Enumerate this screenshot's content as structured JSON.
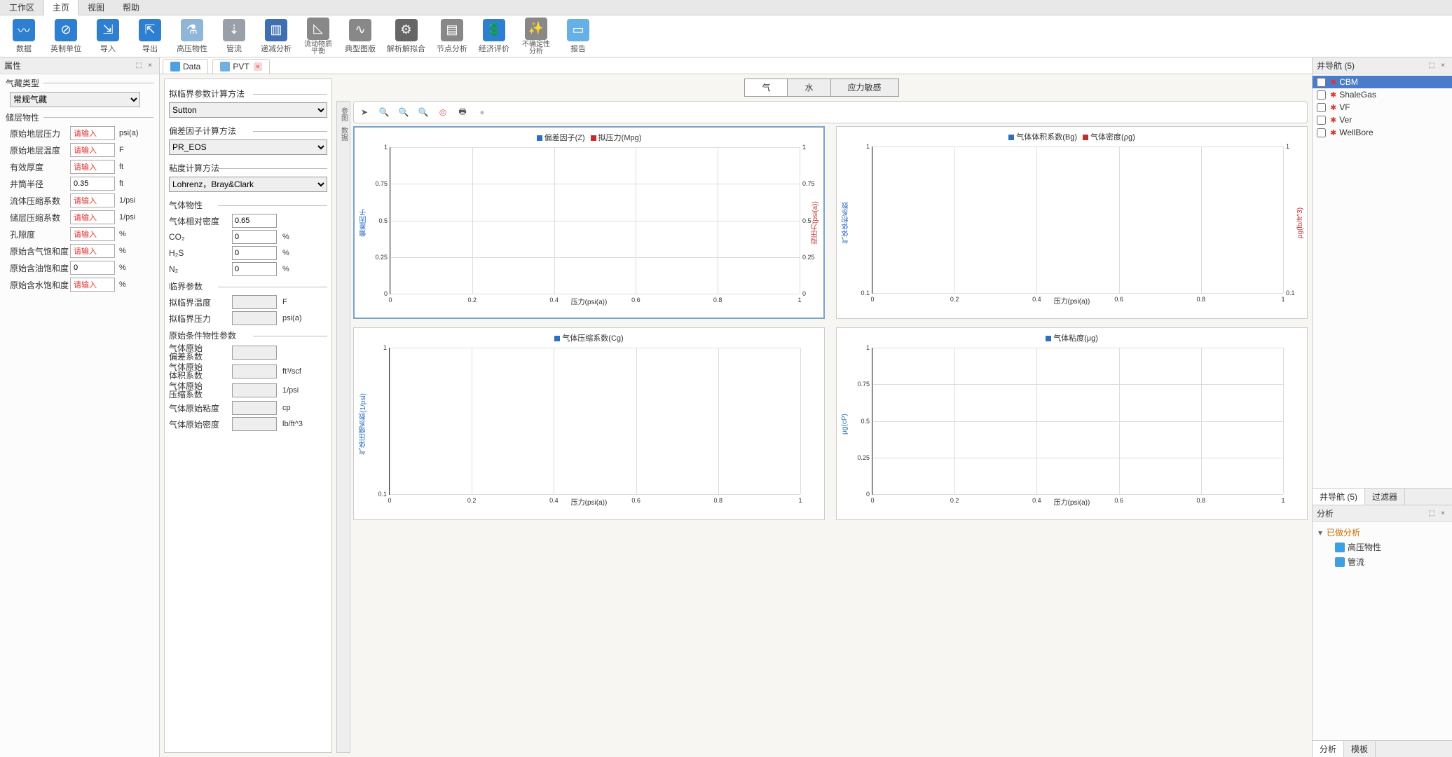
{
  "menubar": {
    "items": [
      "工作区",
      "主页",
      "视图",
      "帮助"
    ],
    "active": 1
  },
  "ribbon": [
    {
      "label": "数据",
      "icon": "wave",
      "bg": "#2f7fd1"
    },
    {
      "label": "英制单位",
      "icon": "circle-slash",
      "bg": "#2f7fd1"
    },
    {
      "label": "导入",
      "icon": "arrow-in",
      "bg": "#2f7fd1"
    },
    {
      "label": "导出",
      "icon": "arrow-out",
      "bg": "#2f7fd1"
    },
    {
      "label": "高压物性",
      "icon": "flask",
      "bg": "#8fb5d9"
    },
    {
      "label": "管流",
      "icon": "drill",
      "bg": "#9aa0a7"
    },
    {
      "label": "递减分析",
      "icon": "bars-down",
      "bg": "#3e6fb0"
    },
    {
      "label": "流动物质\n平衡",
      "icon": "triangle",
      "bg": "#888"
    },
    {
      "label": "典型图版",
      "icon": "curve",
      "bg": "#888"
    },
    {
      "label": "解析解拟合",
      "icon": "gear",
      "bg": "#666"
    },
    {
      "label": "节点分析",
      "icon": "sheets",
      "bg": "#888"
    },
    {
      "label": "经济评价",
      "icon": "money",
      "bg": "#2f7fd1"
    },
    {
      "label": "不确定性\n分析",
      "icon": "wand",
      "bg": "#888"
    },
    {
      "label": "报告",
      "icon": "doc",
      "bg": "#66b0e6"
    }
  ],
  "left": {
    "title": "属性",
    "reservoir_type_label": "气藏类型",
    "reservoir_type_value": "常规气藏",
    "section2": "储层物性",
    "rows": [
      {
        "label": "原始地层压力",
        "value": "请输入",
        "unit": "psi(a)",
        "red": true
      },
      {
        "label": "原始地层温度",
        "value": "请输入",
        "unit": "F",
        "red": true
      },
      {
        "label": "有效厚度",
        "value": "请输入",
        "unit": "ft",
        "red": true
      },
      {
        "label": "井筒半径",
        "value": "0.35",
        "unit": "ft",
        "red": false
      },
      {
        "label": "流体压缩系数",
        "value": "请输入",
        "unit": "1/psi",
        "red": true
      },
      {
        "label": "储层压缩系数",
        "value": "请输入",
        "unit": "1/psi",
        "red": true
      },
      {
        "label": "孔隙度",
        "value": "请输入",
        "unit": "%",
        "red": true
      },
      {
        "label": "原始含气饱和度",
        "value": "请输入",
        "unit": "%",
        "red": true
      },
      {
        "label": "原始含油饱和度",
        "value": "0",
        "unit": "%",
        "red": false
      },
      {
        "label": "原始含水饱和度",
        "value": "请输入",
        "unit": "%",
        "red": true
      }
    ]
  },
  "docTabs": [
    {
      "label": "Data",
      "active": true,
      "icon": "#4aa3e0",
      "closable": false
    },
    {
      "label": "PVT",
      "active": false,
      "icon": "#6fb0e0",
      "closable": true
    }
  ],
  "params": {
    "g1": "拟临界参数计算方法",
    "s1": "Sutton",
    "g2": "偏差因子计算方法",
    "s2": "PR_EOS",
    "g3": "粘度计算方法",
    "s3": "Lohrenz，Bray&Clark",
    "g4": "气体物性",
    "gas": [
      {
        "label": "气体相对密度",
        "value": "0.65",
        "unit": ""
      },
      {
        "label": "CO₂",
        "value": "0",
        "unit": "%"
      },
      {
        "label": "H₂S",
        "value": "0",
        "unit": "%"
      },
      {
        "label": "N₂",
        "value": "0",
        "unit": "%"
      }
    ],
    "g5": "临界参数",
    "crit": [
      {
        "label": "拟临界温度",
        "value": "",
        "unit": "F"
      },
      {
        "label": "拟临界压力",
        "value": "",
        "unit": "psi(a)"
      }
    ],
    "g6": "原始条件物性参数",
    "orig": [
      {
        "label": "气体原始\n偏差系数",
        "value": "",
        "unit": ""
      },
      {
        "label": "气体原始\n体积系数",
        "value": "",
        "unit": "ft³/scf"
      },
      {
        "label": "气体原始\n压缩系数",
        "value": "",
        "unit": "1/psi"
      },
      {
        "label": "气体原始粘度",
        "value": "",
        "unit": "cp"
      },
      {
        "label": "气体原始密度",
        "value": "",
        "unit": "lb/ft^3"
      }
    ]
  },
  "phaseTabs": {
    "items": [
      "气",
      "水",
      "应力敏感"
    ],
    "active": 0
  },
  "sideTools": [
    "参",
    "图",
    "数",
    "据"
  ],
  "sideLabels": {
    "t0": "参图",
    "t1": "数据"
  },
  "charts": [
    {
      "legend": [
        {
          "c": "#2f6fc0",
          "t": "偏差因子(Z)"
        },
        {
          "c": "#c02f2f",
          "t": "拟压力(Mpg)"
        }
      ],
      "y": "偏差因子",
      "y2": "拟压力(psi(a))",
      "xlab": "压力(psi(a))",
      "yticks": [
        "0",
        "0.25",
        "0.5",
        "0.75",
        "1"
      ],
      "xticks": [
        "0",
        "0.2",
        "0.4",
        "0.6",
        "0.8",
        "1"
      ],
      "yc": "#2f6fc0",
      "y2c": "#c02f2f"
    },
    {
      "legend": [
        {
          "c": "#2f6fc0",
          "t": "气体体积系数(Bg)"
        },
        {
          "c": "#c02f2f",
          "t": "气体密度(ρg)"
        }
      ],
      "y": "气体体积系数",
      "y2": "ρg(lb/ft^3)",
      "xlab": "压力(psi(a))",
      "yticks": [
        "0.1",
        "1"
      ],
      "xticks": [
        "0",
        "0.2",
        "0.4",
        "0.6",
        "0.8",
        "1"
      ],
      "yc": "#2f6fc0",
      "y2c": "#c02f2f"
    },
    {
      "legend": [
        {
          "c": "#2f6fc0",
          "t": "气体压缩系数(Cg)"
        }
      ],
      "y": "气体压缩系数(1/psi)",
      "xlab": "压力(psi(a))",
      "yticks": [
        "0.1",
        "1"
      ],
      "xticks": [
        "0",
        "0.2",
        "0.4",
        "0.6",
        "0.8",
        "1"
      ],
      "yc": "#2f6fc0"
    },
    {
      "legend": [
        {
          "c": "#2f6fc0",
          "t": "气体粘度(μg)"
        }
      ],
      "y": "μg(cP)",
      "xlab": "压力(psi(a))",
      "yticks": [
        "0",
        "0.25",
        "0.5",
        "0.75",
        "1"
      ],
      "xticks": [
        "0",
        "0.2",
        "0.4",
        "0.6",
        "0.8",
        "1"
      ],
      "yc": "#2f6fc0"
    }
  ],
  "chart_data": [
    {
      "type": "line",
      "title": "偏差因子(Z) / 拟压力(Mpg)",
      "xlabel": "压力(psi(a))",
      "xlim": [
        0,
        1
      ],
      "series": [
        {
          "name": "偏差因子(Z)",
          "ylabel": "偏差因子",
          "ylim": [
            0,
            1
          ],
          "values": []
        },
        {
          "name": "拟压力(Mpg)",
          "ylabel": "拟压力(psi(a))",
          "ylim": [
            0,
            1
          ],
          "values": []
        }
      ],
      "xticks": [
        0,
        0.2,
        0.4,
        0.6,
        0.8,
        1
      ],
      "yticks": [
        0,
        0.25,
        0.5,
        0.75,
        1
      ]
    },
    {
      "type": "line",
      "title": "气体体积系数(Bg) / 气体密度(ρg)",
      "xlabel": "压力(psi(a))",
      "xlim": [
        0,
        1
      ],
      "series": [
        {
          "name": "气体体积系数(Bg)",
          "ylabel": "气体体积系数",
          "ylim": [
            0.1,
            1
          ],
          "values": []
        },
        {
          "name": "气体密度(ρg)",
          "ylabel": "ρg(lb/ft^3)",
          "ylim": [
            0,
            1
          ],
          "values": []
        }
      ],
      "xticks": [
        0,
        0.2,
        0.4,
        0.6,
        0.8,
        1
      ],
      "yticks": [
        0.1,
        1
      ]
    },
    {
      "type": "line",
      "title": "气体压缩系数(Cg)",
      "xlabel": "压力(psi(a))",
      "xlim": [
        0,
        1
      ],
      "series": [
        {
          "name": "气体压缩系数(Cg)",
          "ylabel": "气体压缩系数(1/psi)",
          "ylim": [
            0.1,
            1
          ],
          "values": []
        }
      ],
      "xticks": [
        0,
        0.2,
        0.4,
        0.6,
        0.8,
        1
      ],
      "yticks": [
        0.1,
        1
      ]
    },
    {
      "type": "line",
      "title": "气体粘度(μg)",
      "xlabel": "压力(psi(a))",
      "xlim": [
        0,
        1
      ],
      "series": [
        {
          "name": "气体粘度(μg)",
          "ylabel": "μg(cP)",
          "ylim": [
            0,
            1
          ],
          "values": []
        }
      ],
      "xticks": [
        0,
        0.2,
        0.4,
        0.6,
        0.8,
        1
      ],
      "yticks": [
        0,
        0.25,
        0.5,
        0.75,
        1
      ]
    }
  ],
  "wellNav": {
    "title": "井导航 (5)",
    "items": [
      "CBM",
      "ShaleGas",
      "VF",
      "Ver",
      "WellBore"
    ],
    "selected": 0,
    "bottomTabs": [
      "井导航 (5)",
      "过滤器"
    ],
    "bottomActive": 0
  },
  "analysis": {
    "title": "分析",
    "root": "已做分析",
    "children": [
      "高压物性",
      "管流"
    ],
    "bottomTabs": [
      "分析",
      "模板"
    ],
    "bottomActive": 0
  }
}
